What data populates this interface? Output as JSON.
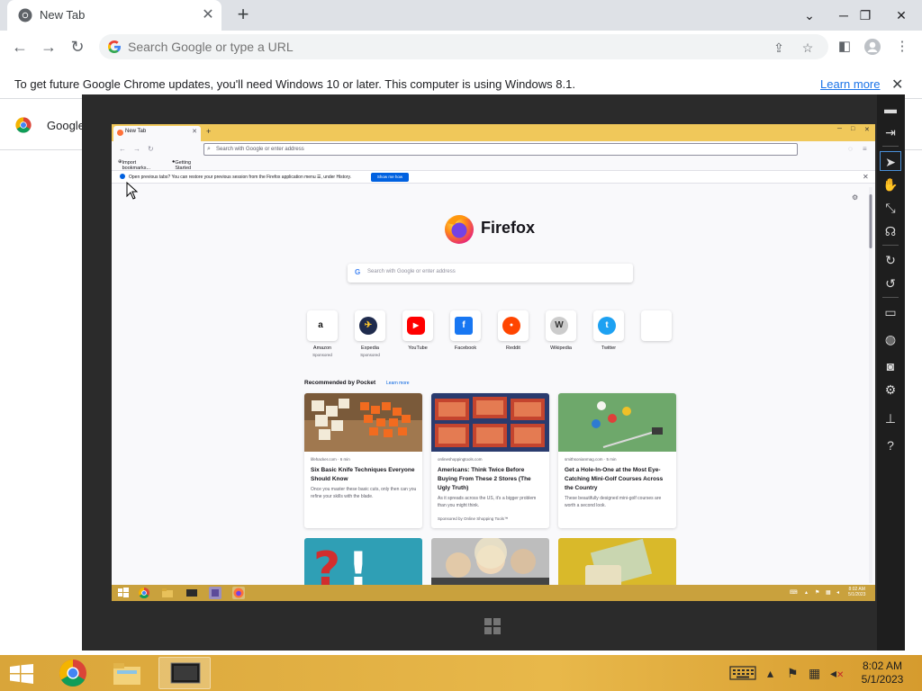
{
  "chrome": {
    "tab_title": "New Tab",
    "omnibox_placeholder": "Search Google or type a URL",
    "infobar_message": "To get future Google Chrome updates, you'll need Windows 10 or later. This computer is using Windows 8.1.",
    "infobar_link": "Learn more",
    "bookmark_label": "Google"
  },
  "firefox": {
    "tab_title": "New Tab",
    "url_placeholder": "Search with Google or enter address",
    "bookmarks": [
      "Import bookmarks...",
      "Getting Started"
    ],
    "notice": "Open previous tabs? You can restore your previous session from the Firefox application menu ☰, under History.",
    "notice_button": "Show me how",
    "brand": "Firefox",
    "search_placeholder": "Search with Google or enter address",
    "tiles": [
      {
        "label": "Amazon",
        "sub": "Sponsored",
        "icon": "amazon-icon",
        "glyph": "a",
        "color": "#ffffff",
        "fg": "#111111"
      },
      {
        "label": "Expedia",
        "sub": "Sponsored",
        "icon": "expedia-icon",
        "glyph": "✈",
        "color": "#1f2b4d",
        "fg": "#ffc72c"
      },
      {
        "label": "YouTube",
        "sub": "",
        "icon": "youtube-icon",
        "glyph": "▶",
        "color": "#ff0000",
        "fg": "#ffffff"
      },
      {
        "label": "Facebook",
        "sub": "",
        "icon": "facebook-icon",
        "glyph": "f",
        "color": "#1877f2",
        "fg": "#ffffff"
      },
      {
        "label": "Reddit",
        "sub": "",
        "icon": "reddit-icon",
        "glyph": "●",
        "color": "#ff4500",
        "fg": "#ffffff"
      },
      {
        "label": "Wikipedia",
        "sub": "",
        "icon": "wikipedia-icon",
        "glyph": "W",
        "color": "#cccccc",
        "fg": "#333333"
      },
      {
        "label": "Twitter",
        "sub": "",
        "icon": "twitter-icon",
        "glyph": "t",
        "color": "#1da1f2",
        "fg": "#ffffff"
      },
      {
        "label": "",
        "sub": "",
        "icon": "empty-tile",
        "glyph": "",
        "color": "#ffffff",
        "fg": "#ffffff"
      }
    ],
    "pocket_heading": "Recommended by Pocket",
    "pocket_link": "Learn more",
    "cards": [
      {
        "source": "lifehacker.com · 6 min",
        "title": "Six Basic Knife Techniques Everyone Should Know",
        "excerpt": "Once you master these basic cuts, only then can you refine your skills with the blade.",
        "sponsor": ""
      },
      {
        "source": "onlineshoppingtools.com",
        "title": "Americans: Think Twice Before Buying From These 2 Stores (The Ugly Truth)",
        "excerpt": "As it spreads across the US, it's a bigger problem than you might think.",
        "sponsor": "Sponsored by Online Shopping Tools™"
      },
      {
        "source": "smithsonianmag.com · 5 min",
        "title": "Get a Hole-In-One at the Most Eye-Catching Mini-Golf Courses Across the Country",
        "excerpt": "These beautifully designed mini-golf courses are worth a second look.",
        "sponsor": ""
      }
    ],
    "taskbar_time": "8:02 AM",
    "taskbar_date": "5/1/2023"
  },
  "taskbar": {
    "time": "8:02 AM",
    "date": "5/1/2023"
  },
  "colors": {
    "chrome_blue": "#1a73e8",
    "taskbar_gold": "#e8b84a",
    "firefox_orange": "#ff7139"
  }
}
